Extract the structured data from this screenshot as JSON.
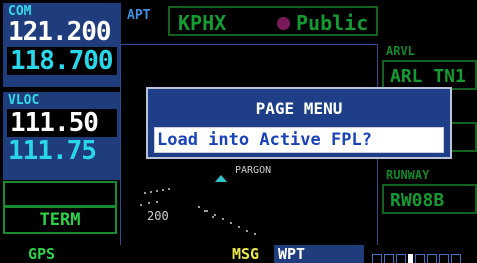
{
  "com": {
    "label": "COM",
    "active": "121.200",
    "standby": "118.700"
  },
  "vloc": {
    "label": "VLOC",
    "active": "111.50",
    "standby": "111.75"
  },
  "flight_phase": "TERM",
  "header": {
    "page": "APT",
    "ident": "KPHX",
    "type": "Public"
  },
  "right_panel": {
    "arrival_label": "ARVL",
    "arrival_value": "ARL TN1",
    "runway_label": "RUNWAY",
    "runway_value": "RW08B"
  },
  "map": {
    "label": "PARGON",
    "range": "200"
  },
  "menu": {
    "title": "PAGE MENU",
    "item": "Load into Active FPL?"
  },
  "status": {
    "mode": "GPS",
    "msg": "MSG",
    "page": "WPT",
    "page_count": 8,
    "current_page": 4
  },
  "colors": {
    "accent": "#1f3d7d",
    "cyan": "#2ad7ea",
    "dim_green": "#159a33",
    "status_yellow": "#e8e84a"
  }
}
